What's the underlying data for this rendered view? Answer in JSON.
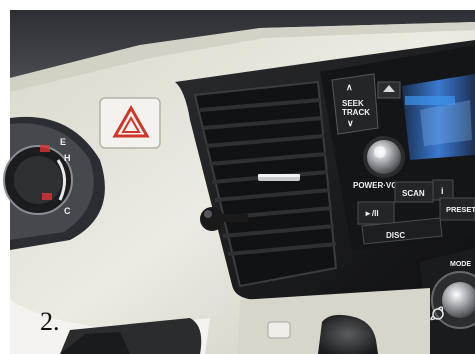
{
  "caption": "2.",
  "gauge": {
    "marks": [
      "E",
      "H",
      "C"
    ]
  },
  "radio": {
    "seek_track_label": "SEEK\nTRACK",
    "power_vol_label": "POWER·VOL",
    "scan_label": "SCAN",
    "presets_label": "PRESETS",
    "play_label": "►/II",
    "disc_label": "DISC",
    "info_label": "i"
  },
  "climate": {
    "mode_label": "MODE"
  },
  "icons": {
    "hazard": "hazard-triangle-icon",
    "eject": "eject-icon",
    "fan": "fan-icon",
    "seek_up": "chevron-up-icon",
    "seek_down": "chevron-down-icon"
  },
  "colors": {
    "dash_panel": "#e6e3d6",
    "dash_top": "#3a3d40",
    "bezel": "#1e1f21",
    "hazard_red": "#d0352a",
    "display_blue": "#2f7fd8"
  }
}
